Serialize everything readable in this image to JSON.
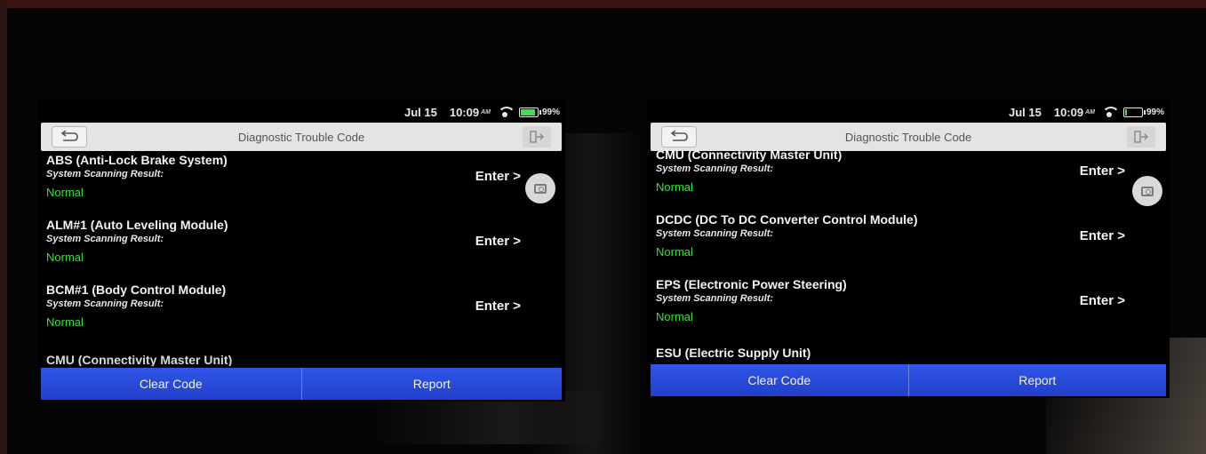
{
  "status": {
    "date": "Jul 15",
    "time": "10:09",
    "ampm": "AM",
    "battery_percent": "99%",
    "battery_level": 0.99
  },
  "header": {
    "title": "Diagnostic Trouble Code"
  },
  "scan_label": "System Scanning Result:",
  "enter_label": "Enter >",
  "left_screen": {
    "items": [
      {
        "name": "ABS (Anti-Lock Brake System)",
        "result": "Normal"
      },
      {
        "name": "ALM#1 (Auto Leveling Module)",
        "result": "Normal"
      },
      {
        "name": "BCM#1 (Body Control Module)",
        "result": "Normal"
      },
      {
        "name": "CMU (Connectivity Master Unit)"
      }
    ]
  },
  "right_screen": {
    "items": [
      {
        "name": "CMU (Connectivity Master Unit)",
        "result": "Normal"
      },
      {
        "name": "DCDC (DC To DC Converter Control Module)",
        "result": "Normal"
      },
      {
        "name": "EPS (Electronic Power Steering)",
        "result": "Normal"
      },
      {
        "name": "ESU (Electric Supply Unit)"
      }
    ]
  },
  "footer": {
    "clear_code_label": "Clear Code",
    "report_label": "Report"
  },
  "colors": {
    "result_normal": "#36e03c",
    "action_bar": "#2446d6",
    "battery": "#3ee04b"
  }
}
